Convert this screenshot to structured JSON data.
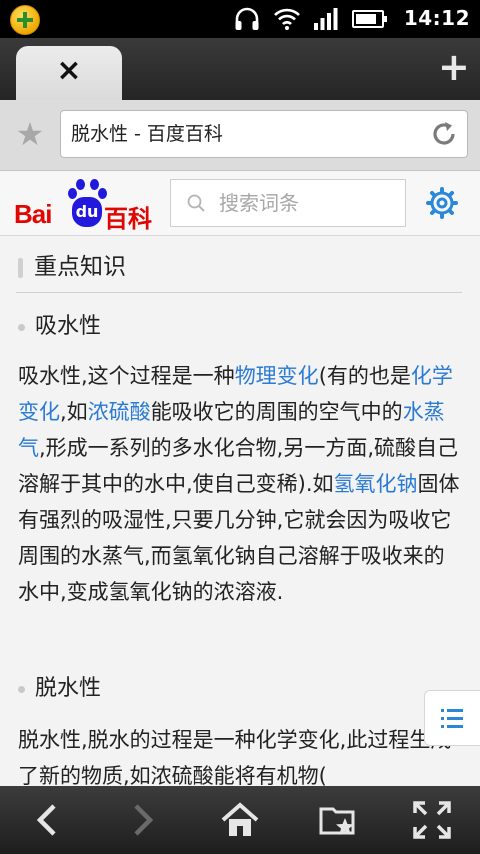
{
  "status_bar": {
    "time": "14:12"
  },
  "tab": {
    "close_symbol": "×",
    "new_tab_symbol": "+"
  },
  "address_bar": {
    "url_title": "脱水性 - 百度百科"
  },
  "baidu": {
    "logo_bai": "Bai",
    "logo_du": "du",
    "logo_baike": "百科",
    "search_placeholder": "搜索词条"
  },
  "article": {
    "section_title": "重点知识",
    "sub1": "吸水性",
    "para1": [
      {
        "t": "吸水性,这个过程是一种"
      },
      {
        "t": "物理变化",
        "link": true
      },
      {
        "t": "(有的也是"
      },
      {
        "t": "化学变化",
        "link": true
      },
      {
        "t": ",如"
      },
      {
        "t": "浓硫酸",
        "link": true
      },
      {
        "t": "能吸收它的周围的空气中的"
      },
      {
        "t": "水蒸气",
        "link": true
      },
      {
        "t": ",形成一系列的多水化合物,另一方面,硫酸自己溶解于其中的水中,使自己变稀).如"
      },
      {
        "t": "氢氧化钠",
        "link": true
      },
      {
        "t": "固体有强烈的吸湿性,只要几分钟,它就会因为吸收它周围的水蒸气,而氢氧化钠自己溶解于吸收来的水中,变成氢氧化钠的浓溶液."
      }
    ],
    "sub2": "脱水性",
    "para2": "脱水性,脱水的过程是一种化学变化,此过程生成了新的物质,如浓硫酸能将有机物("
  },
  "colors": {
    "link": "#2b7bd4",
    "baidu_red": "#e10602",
    "baidu_blue": "#2319dc",
    "gear": "#2b88d8"
  },
  "icons": [
    "app-notification-icon",
    "headset-icon",
    "wifi-icon",
    "signal-icon",
    "battery-icon",
    "close-icon",
    "plus-icon",
    "star-icon",
    "reload-icon",
    "search-icon",
    "gear-icon",
    "list-icon",
    "back-icon",
    "forward-icon",
    "home-icon",
    "bookmarks-folder-icon",
    "fullscreen-icon"
  ]
}
